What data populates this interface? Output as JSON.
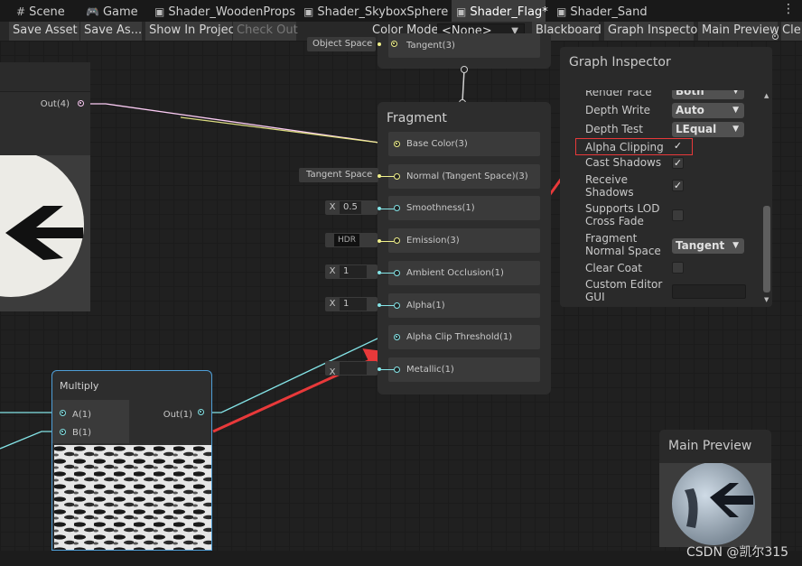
{
  "tabs": [
    {
      "label": "Scene",
      "icon": "grid-icon"
    },
    {
      "label": "Game",
      "icon": "gamepad-icon"
    },
    {
      "label": "Shader_WoodenProps",
      "icon": "shader-graph-icon"
    },
    {
      "label": "Shader_SkyboxSphere",
      "icon": "shader-graph-icon"
    },
    {
      "label": "Shader_Flag*",
      "icon": "shader-graph-icon",
      "active": true
    },
    {
      "label": "Shader_Sand",
      "icon": "shader-graph-icon"
    }
  ],
  "toolbar": {
    "save_asset": "Save Asset",
    "save_as": "Save As...",
    "show_in_project": "Show In Project",
    "check_out": "Check Out",
    "color_mode_label": "Color Mode",
    "color_mode_value": "<None>",
    "blackboard": "Blackboard",
    "graph_inspector": "Graph Inspector",
    "main_preview": "Main Preview",
    "clear": "Cle"
  },
  "left_node": {
    "out_label": "Out(4)"
  },
  "vertex_tail": {
    "object_space": "Object Space",
    "tangent": "Tangent(3)"
  },
  "fragment": {
    "title": "Fragment",
    "slots": [
      {
        "label": "Base Color(3)"
      },
      {
        "label": "Normal (Tangent Space)(3)"
      },
      {
        "label": "Smoothness(1)"
      },
      {
        "label": "Emission(3)"
      },
      {
        "label": "Ambient Occlusion(1)"
      },
      {
        "label": "Alpha(1)"
      },
      {
        "label": "Alpha Clip Threshold(1)"
      },
      {
        "label": "Metallic(1)"
      }
    ],
    "inputs": {
      "tangent_space": "Tangent Space",
      "smoothness_x": "X",
      "smoothness_v": "0.5",
      "emission_hdr": "HDR",
      "ao_x": "X",
      "ao_v": "1",
      "alpha_x": "X",
      "alpha_v": "1",
      "metallic_x": "X"
    }
  },
  "multiply": {
    "title": "Multiply",
    "in_a": "A(1)",
    "in_b": "B(1)",
    "out": "Out(1)"
  },
  "inspector": {
    "title": "Graph Inspector",
    "render_face_label": "Render Face",
    "render_face_value": "Both",
    "depth_write_label": "Depth Write",
    "depth_write_value": "Auto",
    "depth_test_label": "Depth Test",
    "depth_test_value": "LEqual",
    "alpha_clipping_label": "Alpha Clipping",
    "cast_shadows_label": "Cast Shadows",
    "receive_shadows_label_1": "Receive",
    "receive_shadows_label_2": "Shadows",
    "supports_lod_label_1": "Supports LOD",
    "supports_lod_label_2": "Cross Fade",
    "fragment_normal_label_1": "Fragment",
    "fragment_normal_label_2": "Normal Space",
    "fragment_normal_value": "Tangent",
    "clear_coat_label": "Clear Coat",
    "custom_editor_label_1": "Custom Editor",
    "custom_editor_label_2": "GUI",
    "alpha_clipping_checked": true,
    "cast_shadows_checked": true,
    "receive_shadows_checked": true,
    "supports_lod_checked": false,
    "clear_coat_checked": false
  },
  "preview": {
    "title": "Main Preview"
  },
  "watermark": "CSDN @凯尔315",
  "colors": {
    "annotation_red": "#e8393a",
    "port_vector3": "#f0f08a",
    "port_vector1": "#84e4e7",
    "port_vector4": "#fbcbf4"
  }
}
